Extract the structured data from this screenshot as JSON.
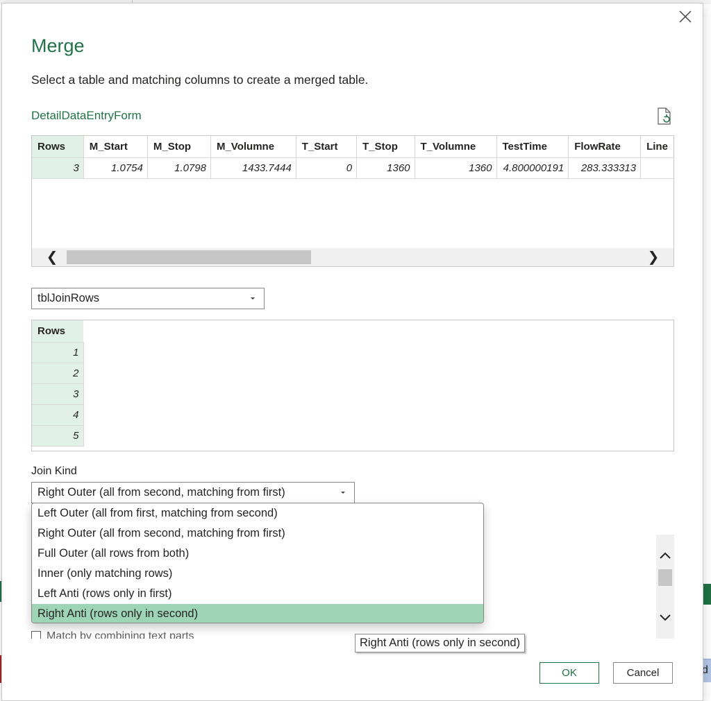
{
  "dialog": {
    "title": "Merge",
    "subtitle": "Select a table and matching columns to create a merged table."
  },
  "table1": {
    "name": "DetailDataEntryForm",
    "columns": [
      "Rows",
      "M_Start",
      "M_Stop",
      "M_Volumne",
      "T_Start",
      "T_Stop",
      "T_Volumne",
      "TestTime",
      "FlowRate",
      "Line"
    ],
    "rows": [
      [
        "3",
        "1.0754",
        "1.0798",
        "1433.7444",
        "0",
        "1360",
        "1360",
        "4.800000191",
        "283.333313",
        ""
      ]
    ]
  },
  "table2": {
    "selected": "tblJoinRows",
    "columns": [
      "Rows"
    ],
    "rows": [
      [
        "1"
      ],
      [
        "2"
      ],
      [
        "3"
      ],
      [
        "4"
      ],
      [
        "5"
      ]
    ]
  },
  "join": {
    "label": "Join Kind",
    "selected": "Right Outer (all from second, matching from first)",
    "options": [
      "Left Outer (all from first, matching from second)",
      "Right Outer (all from second, matching from first)",
      "Full Outer (all rows from both)",
      "Inner (only matching rows)",
      "Left Anti (rows only in first)",
      "Right Anti (rows only in second)"
    ],
    "highlighted_index": 5
  },
  "hidden_option": "Match by combining text parts",
  "tooltip": "Right Anti (rows only in second)",
  "buttons": {
    "ok": "OK",
    "cancel": "Cancel"
  },
  "background": {
    "right_edge_text": "d"
  },
  "colors": {
    "accent": "#217346",
    "rows_column_bg": "#e2f1e8",
    "selected_option_bg": "#9fd5b7"
  }
}
